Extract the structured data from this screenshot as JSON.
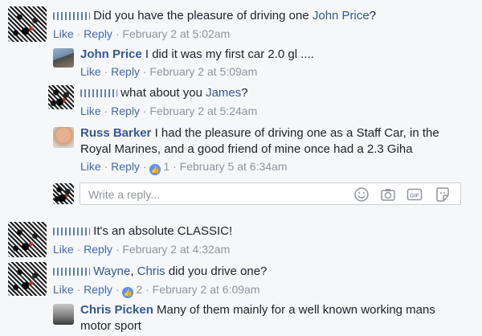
{
  "actions": {
    "like": "Like",
    "reply": "Reply",
    "sep": "·"
  },
  "colors": {
    "link": "#365899",
    "action": "#4267b2",
    "meta": "#90949c",
    "like_badge": "#5890ff"
  },
  "comments": [
    {
      "text": "Did you have the pleasure of driving one",
      "mention": "John Price",
      "text_after": "?",
      "time": "February 2 at 5:02am",
      "replies": [
        {
          "author": "John Price",
          "text": "I did it was my first car 2.0 gl ....",
          "time": "February 2 at 5:09am"
        },
        {
          "text": "what about you",
          "mention": "James",
          "text_after": "?",
          "time": "February 2 at 5:24am"
        },
        {
          "author": "Russ Barker",
          "text": "I had the pleasure of driving one as a Staff Car, in the",
          "text2": "Royal Marines, and a good friend of mine once had a 2.3 Giha",
          "likes": "1",
          "time": "February 5 at 6:34am"
        }
      ],
      "reply_placeholder": "Write a reply..."
    },
    {
      "text": "It's an absolute CLASSIC!",
      "time": "February 2 at 4:32am"
    },
    {
      "mention": "Wayne",
      "sep_comma": ",",
      "mention2": "Chris",
      "text_after": "did you drive one?",
      "likes": "2",
      "time": "February 2 at 6:09am",
      "replies": [
        {
          "author": "Chris Picken",
          "text": "Many of them mainly for a well known working mans",
          "text2": "motor sport"
        }
      ]
    }
  ]
}
